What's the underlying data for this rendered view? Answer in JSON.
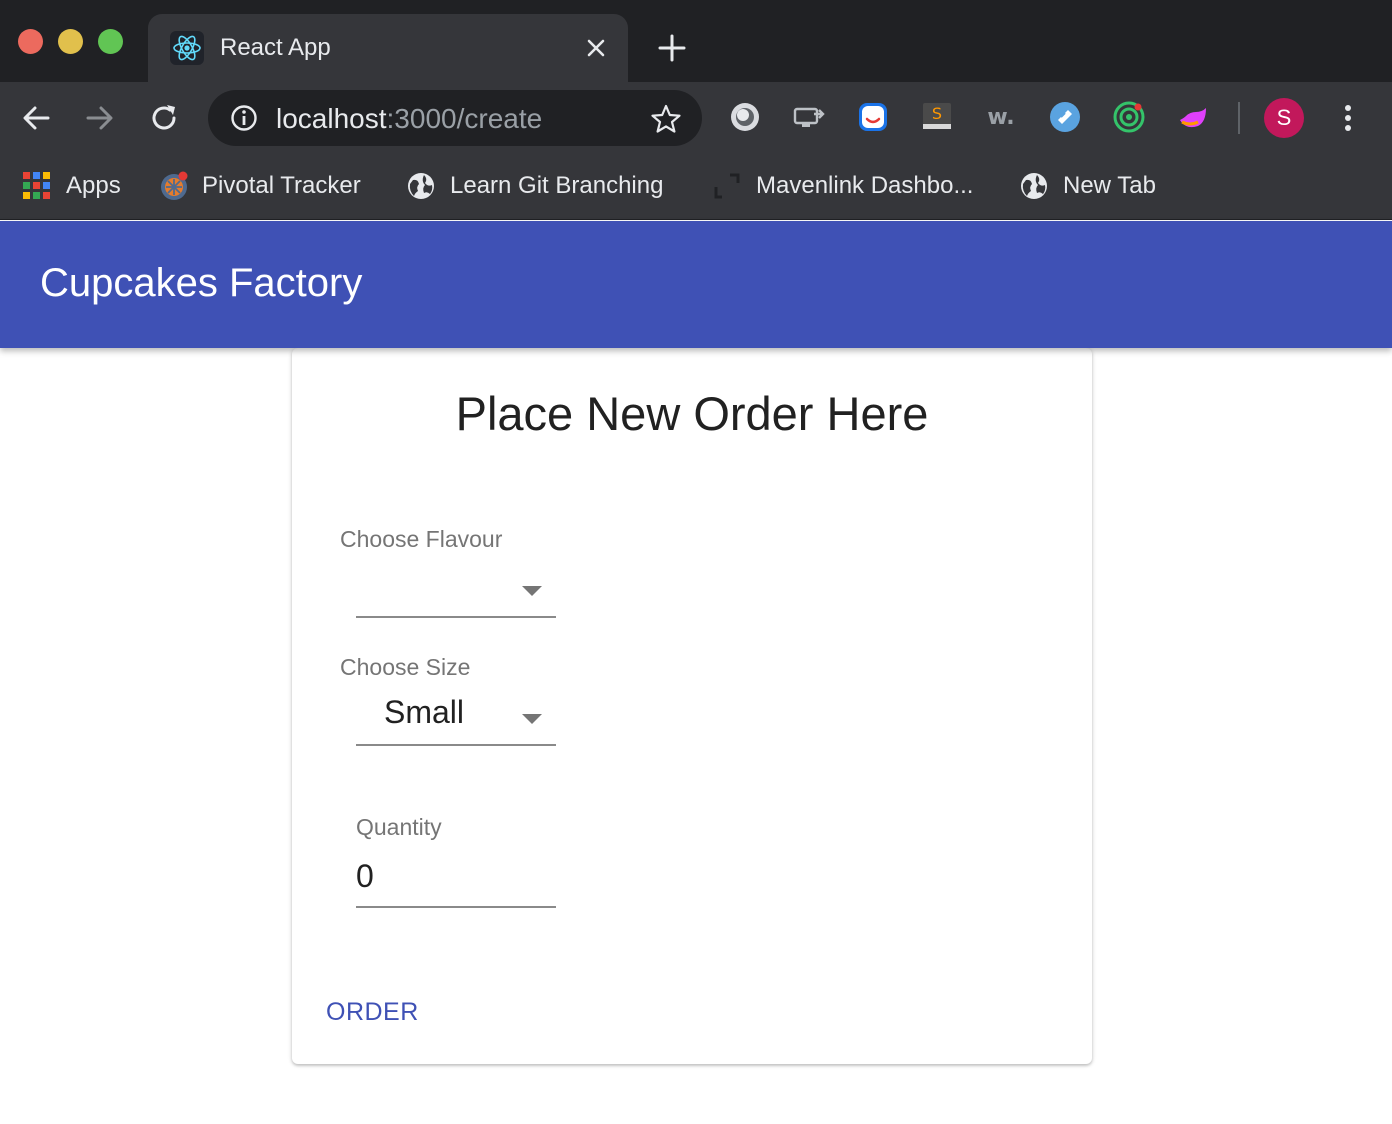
{
  "browser": {
    "tab": {
      "title": "React App",
      "favicon": "react-atom-icon"
    },
    "url": {
      "host": "localhost",
      "path": ":3000/create"
    },
    "extensions": [
      "record-ext-icon",
      "screen-cast-ext-icon",
      "chat-ext-icon",
      "sublime-ext-icon",
      "w-ext-icon",
      "pocket-ext-icon",
      "target-ext-icon",
      "bird-ext-icon"
    ],
    "profile_initial": "S",
    "bookmarks": [
      {
        "label": "Apps",
        "icon": "apps-grid-icon"
      },
      {
        "label": "Pivotal Tracker",
        "icon": "pivotal-tracker-icon"
      },
      {
        "label": "Learn Git Branching",
        "icon": "globe-icon"
      },
      {
        "label": "Mavenlink Dashbo...",
        "icon": "mavenlink-icon"
      },
      {
        "label": "New Tab",
        "icon": "globe-icon"
      }
    ]
  },
  "app": {
    "title": "Cupcakes Factory"
  },
  "form": {
    "heading": "Place New Order Here",
    "flavour": {
      "label": "Choose Flavour",
      "value": ""
    },
    "size": {
      "label": "Choose Size",
      "value": "Small"
    },
    "quantity": {
      "label": "Quantity",
      "value": "0"
    },
    "submit_label": "ORDER"
  },
  "colors": {
    "primary": "#3f51b5",
    "chrome_dark": "#202124",
    "chrome_toolbar": "#35363a",
    "avatar": "#c2185b"
  }
}
